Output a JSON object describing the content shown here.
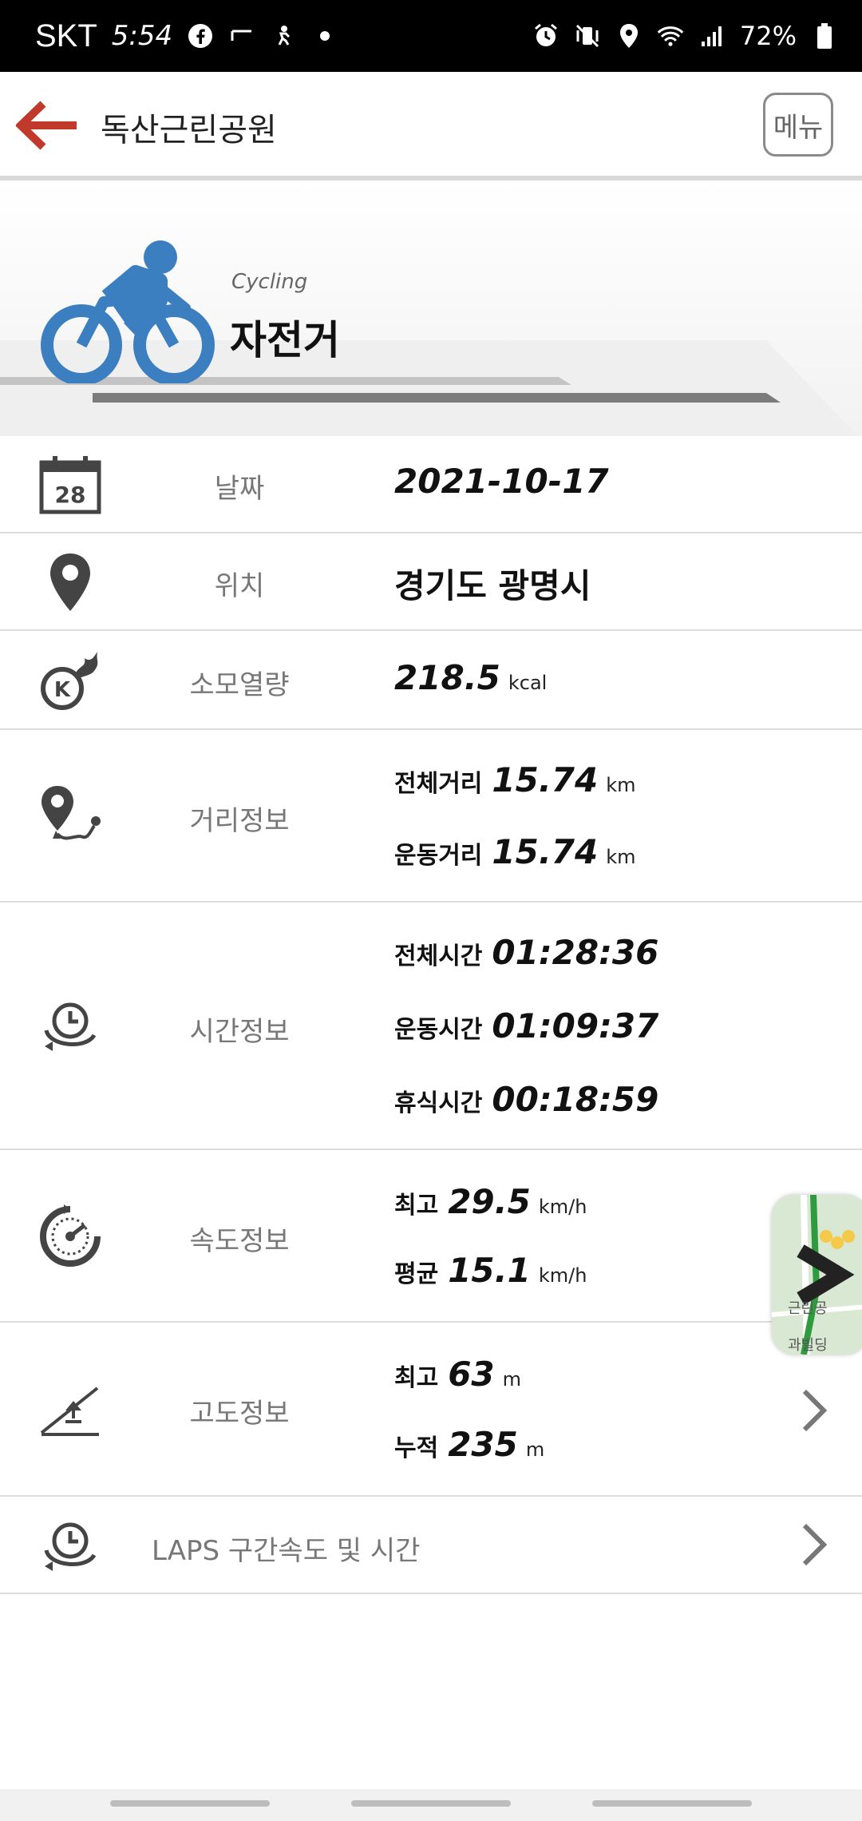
{
  "status_bar": {
    "carrier": "SKT",
    "time": "5:54",
    "battery": "72%"
  },
  "header": {
    "title": "독산근린공원",
    "menu_label": "메뉴"
  },
  "activity": {
    "subtitle": "Cycling",
    "title": "자전거",
    "color": "#3b7fc0"
  },
  "rows": {
    "date": {
      "label": "날짜",
      "value": "2021-10-17",
      "icon_day": "28"
    },
    "location": {
      "label": "위치",
      "value": "경기도 광명시"
    },
    "calories": {
      "label": "소모열량",
      "value": "218.5",
      "unit": "kcal"
    },
    "distance": {
      "label": "거리정보",
      "total_label": "전체거리",
      "total_value": "15.74",
      "total_unit": "km",
      "exercise_label": "운동거리",
      "exercise_value": "15.74",
      "exercise_unit": "km"
    },
    "time": {
      "label": "시간정보",
      "total_label": "전체시간",
      "total_value": "01:28:36",
      "exercise_label": "운동시간",
      "exercise_value": "01:09:37",
      "rest_label": "휴식시간",
      "rest_value": "00:18:59"
    },
    "speed": {
      "label": "속도정보",
      "max_label": "최고",
      "max_value": "29.5",
      "max_unit": "km/h",
      "avg_label": "평균",
      "avg_value": "15.1",
      "avg_unit": "km/h"
    },
    "altitude": {
      "label": "고도정보",
      "max_label": "최고",
      "max_value": "63",
      "max_unit": "m",
      "cum_label": "누적",
      "cum_value": "235",
      "cum_unit": "m"
    },
    "laps": {
      "label": "LAPS 구간속도 및 시간"
    }
  },
  "map_thumb": {
    "text_top": "근린공",
    "text_bottom": "과빌딩"
  },
  "colors": {
    "back_arrow": "#c0392b",
    "icon_gray": "#444444",
    "label_gray": "#777777"
  }
}
